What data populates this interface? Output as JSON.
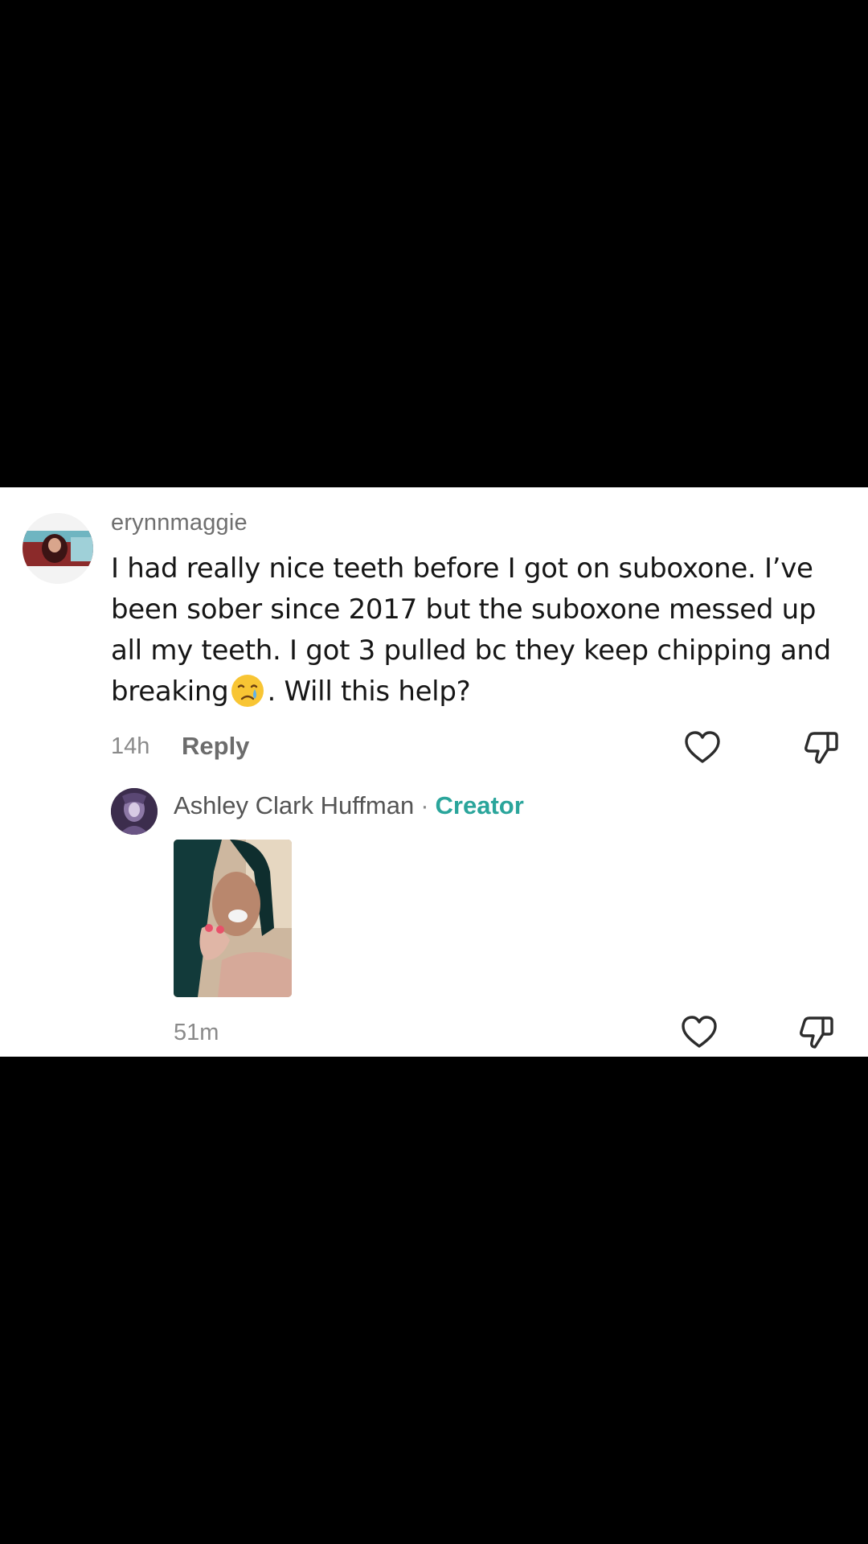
{
  "comment": {
    "username": "erynnmaggie",
    "text_before_emoji": "I had really nice teeth before I got on suboxone. I’ve been sober since 2017 but the suboxone messed up all my teeth. I got 3 pulled bc they keep chipping and breaking",
    "emoji": "crying-face",
    "text_after_emoji": ". Will this help?",
    "time": "14h",
    "reply_label": "Reply"
  },
  "reply": {
    "author": "Ashley Clark Huffman",
    "separator": "·",
    "badge": "Creator",
    "time": "51m"
  },
  "colors": {
    "background": "#000000",
    "card": "#ffffff",
    "creator_badge": "#2aa59b"
  },
  "icons": [
    "heart-outline-icon",
    "thumbs-down-outline-icon"
  ]
}
